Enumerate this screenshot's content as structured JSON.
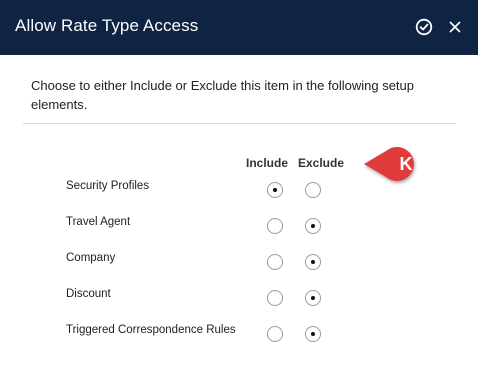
{
  "dialog": {
    "title": "Allow Rate Type Access",
    "description": "Choose to either Include or Exclude this item in the following setup elements."
  },
  "columns": {
    "include": "Include",
    "exclude": "Exclude"
  },
  "rows": [
    {
      "label": "Security Profiles",
      "selected": "include"
    },
    {
      "label": "Travel Agent",
      "selected": "exclude"
    },
    {
      "label": "Company",
      "selected": "exclude"
    },
    {
      "label": "Discount",
      "selected": "exclude"
    },
    {
      "label": "Triggered Correspondence Rules",
      "selected": "exclude"
    }
  ],
  "callout": {
    "letter": "K",
    "color": "#e03a3a"
  },
  "colors": {
    "header": "#0f2343"
  }
}
